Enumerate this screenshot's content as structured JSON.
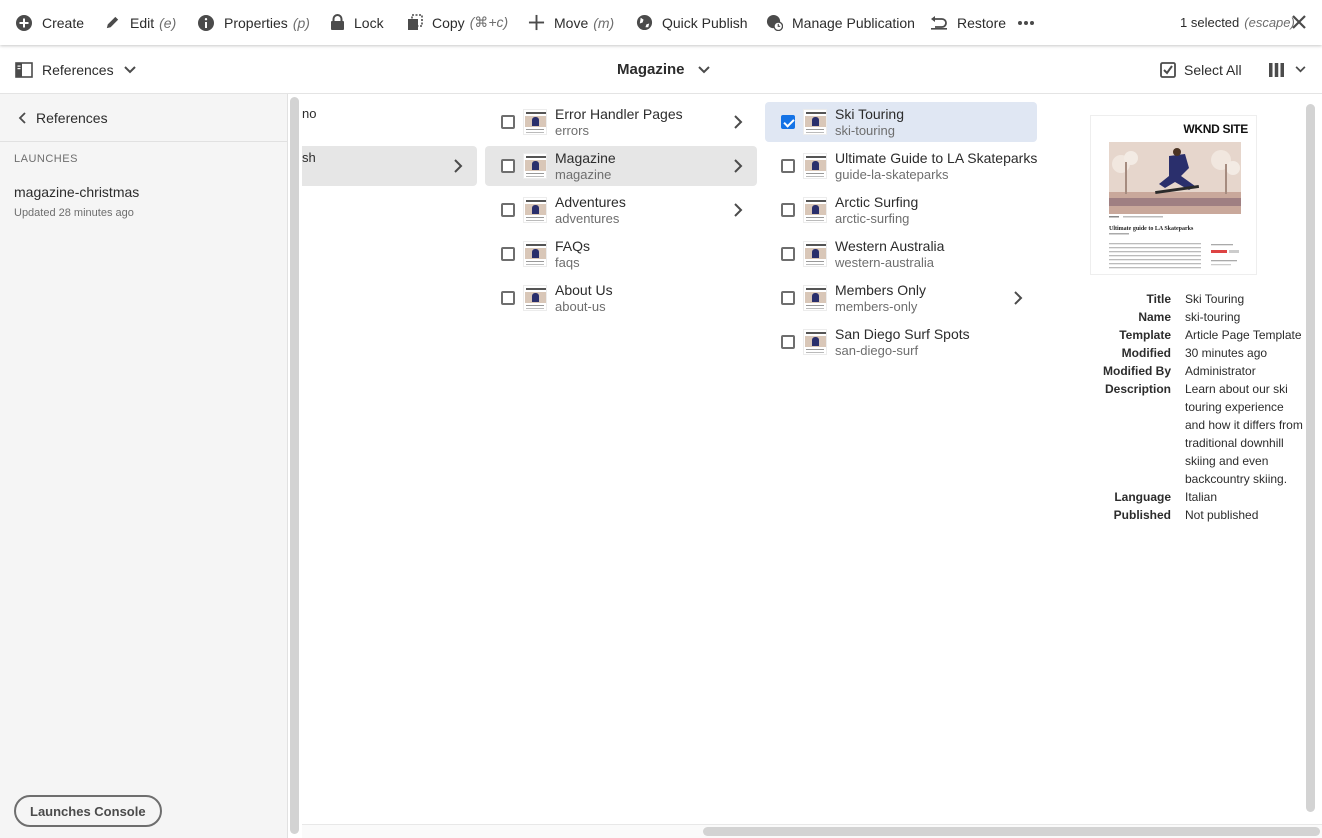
{
  "actionbar": {
    "create": "Create",
    "edit": "Edit",
    "edit_key": "(e)",
    "properties": "Properties",
    "properties_key": "(p)",
    "lock": "Lock",
    "copy": "Copy",
    "copy_key": "(⌘+c)",
    "move": "Move",
    "move_key": "(m)",
    "quick_publish": "Quick Publish",
    "manage_publication": "Manage Publication",
    "restore": "Restore",
    "more_icon": "more-ellipsis-icon",
    "selected": "1 selected",
    "selected_key": "(escape)"
  },
  "header": {
    "rail_label": "References",
    "title": "Magazine",
    "select_all": "Select All"
  },
  "rail": {
    "back_label": "References",
    "section": "LAUNCHES",
    "launch_name": "magazine-christmas",
    "launch_updated": "Updated 28 minutes ago",
    "console_button": "Launches Console"
  },
  "columns": {
    "col1_fragments": [
      "no",
      "sh"
    ],
    "col2": [
      {
        "title": "Error Handler Pages",
        "name": "errors"
      },
      {
        "title": "Magazine",
        "name": "magazine"
      },
      {
        "title": "Adventures",
        "name": "adventures"
      },
      {
        "title": "FAQs",
        "name": "faqs"
      },
      {
        "title": "About Us",
        "name": "about-us"
      }
    ],
    "col3": [
      {
        "title": "Ski Touring",
        "name": "ski-touring"
      },
      {
        "title": "Ultimate Guide to LA Skateparks",
        "name": "guide-la-skateparks"
      },
      {
        "title": "Arctic Surfing",
        "name": "arctic-surfing"
      },
      {
        "title": "Western Australia",
        "name": "western-australia"
      },
      {
        "title": "Members Only",
        "name": "members-only"
      },
      {
        "title": "San Diego Surf Spots",
        "name": "san-diego-surf"
      }
    ]
  },
  "preview": {
    "logo": "WKND SITE",
    "headline": "Ultimate guide to LA Skateparks"
  },
  "properties": [
    {
      "key": "Title",
      "value": "Ski Touring"
    },
    {
      "key": "Name",
      "value": "ski-touring"
    },
    {
      "key": "Template",
      "value": "Article Page Template"
    },
    {
      "key": "Modified",
      "value": "30 minutes ago"
    },
    {
      "key": "Modified By",
      "value": "Administrator"
    },
    {
      "key": "Description",
      "value": "Learn about our ski touring experience and how it differs from traditional downhill skiing and even backcountry skiing."
    },
    {
      "key": "Language",
      "value": "Italian"
    },
    {
      "key": "Published",
      "value": "Not published"
    }
  ],
  "colors": {
    "accent": "#1473e6",
    "selected_row": "#e0e7f3",
    "hover_row": "#e6e6e6",
    "rail_bg": "#f5f5f5"
  }
}
